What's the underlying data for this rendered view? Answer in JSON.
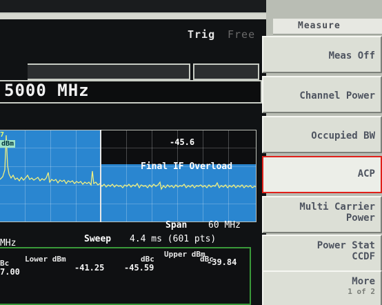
{
  "trigger": {
    "label": "Trig",
    "value": "Free"
  },
  "center_freq": "5000 MHz",
  "graph": {
    "marker_value": "7",
    "marker_unit": "dBm",
    "limit_value": "-45.6",
    "overload_message": "Final IF Overload",
    "trace_color": "#f0f080",
    "fill_color": "#2a86d0"
  },
  "span": {
    "label": "Span",
    "value": "60 MHz"
  },
  "sweep": {
    "label": "Sweep",
    "value": "4.4 ms (601 pts)"
  },
  "mhz_left": "MHz",
  "results": {
    "lower_header": "Lower dBm",
    "upper_header": "Upper dBm",
    "dbc_left": "Bc",
    "dbc_right_lower": "dBc",
    "dbc_right_upper": "dBc",
    "row": {
      "ref": "7.00",
      "lower_dbm": "-41.25",
      "upper_dbc": "-45.59",
      "upper_dbm": "-39.84"
    }
  },
  "menu": {
    "title": "Measure",
    "items": [
      {
        "label": "Meas Off",
        "selected": false
      },
      {
        "label": "Channel Power",
        "selected": false
      },
      {
        "label": "Occupied BW",
        "selected": false
      },
      {
        "label": "ACP",
        "selected": true
      },
      {
        "label_line1": "Multi Carrier",
        "label_line2": "Power",
        "selected": false
      },
      {
        "label_line1": "Power Stat",
        "label_line2": "CCDF",
        "selected": false
      },
      {
        "label_line1": "More",
        "label_line2": "1 of 2",
        "selected": false
      }
    ]
  },
  "colors": {
    "selection_outline": "#e0201a",
    "results_border": "#3a9a3a"
  }
}
